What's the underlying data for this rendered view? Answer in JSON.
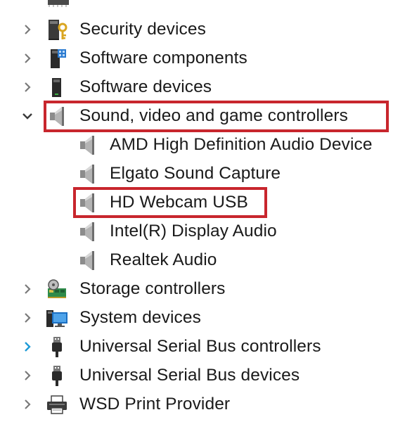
{
  "tree": {
    "top_partial_icon": "device-icon",
    "rows": [
      {
        "key": "security",
        "label": "Security devices",
        "level": 0,
        "expander": "collapsed",
        "icon": "security-devices-icon"
      },
      {
        "key": "software-components",
        "label": "Software components",
        "level": 0,
        "expander": "collapsed",
        "icon": "software-components-icon"
      },
      {
        "key": "software-devices",
        "label": "Software devices",
        "level": 0,
        "expander": "collapsed",
        "icon": "software-devices-icon"
      },
      {
        "key": "sound",
        "label": "Sound, video and game controllers",
        "level": 0,
        "expander": "expanded",
        "icon": "speaker-icon",
        "highlighted": true
      },
      {
        "key": "amd-audio",
        "label": "AMD High Definition Audio Device",
        "level": 1,
        "icon": "speaker-icon"
      },
      {
        "key": "elgato",
        "label": "Elgato Sound Capture",
        "level": 1,
        "icon": "speaker-icon"
      },
      {
        "key": "hd-webcam",
        "label": "HD Webcam USB",
        "level": 1,
        "icon": "speaker-icon",
        "highlighted": true
      },
      {
        "key": "intel-display-audio",
        "label": "Intel(R) Display Audio",
        "level": 1,
        "icon": "speaker-icon"
      },
      {
        "key": "realtek",
        "label": "Realtek Audio",
        "level": 1,
        "icon": "speaker-icon"
      },
      {
        "key": "storage",
        "label": "Storage controllers",
        "level": 0,
        "expander": "collapsed",
        "icon": "storage-controller-icon"
      },
      {
        "key": "system",
        "label": "System devices",
        "level": 0,
        "expander": "collapsed",
        "icon": "system-devices-icon"
      },
      {
        "key": "usb-controllers",
        "label": "Universal Serial Bus controllers",
        "level": 0,
        "expander": "collapsed-hover",
        "icon": "usb-icon"
      },
      {
        "key": "usb-devices",
        "label": "Universal Serial Bus devices",
        "level": 0,
        "expander": "collapsed",
        "icon": "usb-icon"
      },
      {
        "key": "wsd",
        "label": "WSD Print Provider",
        "level": 0,
        "expander": "collapsed",
        "icon": "printer-icon"
      }
    ]
  },
  "colors": {
    "highlight_border": "#c8262d",
    "chevron": "#7a7a7a",
    "chevron_hover": "#1e9bd7",
    "text": "#1a1a1a"
  }
}
